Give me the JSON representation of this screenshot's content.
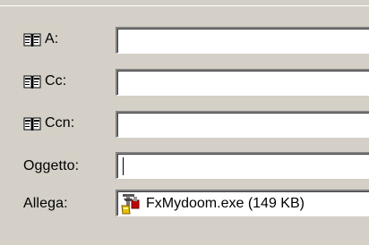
{
  "fields": {
    "to": {
      "label": "A:",
      "value": ""
    },
    "cc": {
      "label": "Cc:",
      "value": ""
    },
    "bcc": {
      "label": "Ccn:",
      "value": ""
    },
    "subject": {
      "label": "Oggetto:",
      "value": ""
    },
    "attach": {
      "label": "Allega:",
      "file": "FxMydoom.exe (149 KB)"
    }
  },
  "icons": {
    "address_book": "address-book-icon",
    "attachment": "exe-file-icon"
  },
  "colors": {
    "window_bg": "#d4d0c8",
    "field_bg": "#ffffff"
  }
}
